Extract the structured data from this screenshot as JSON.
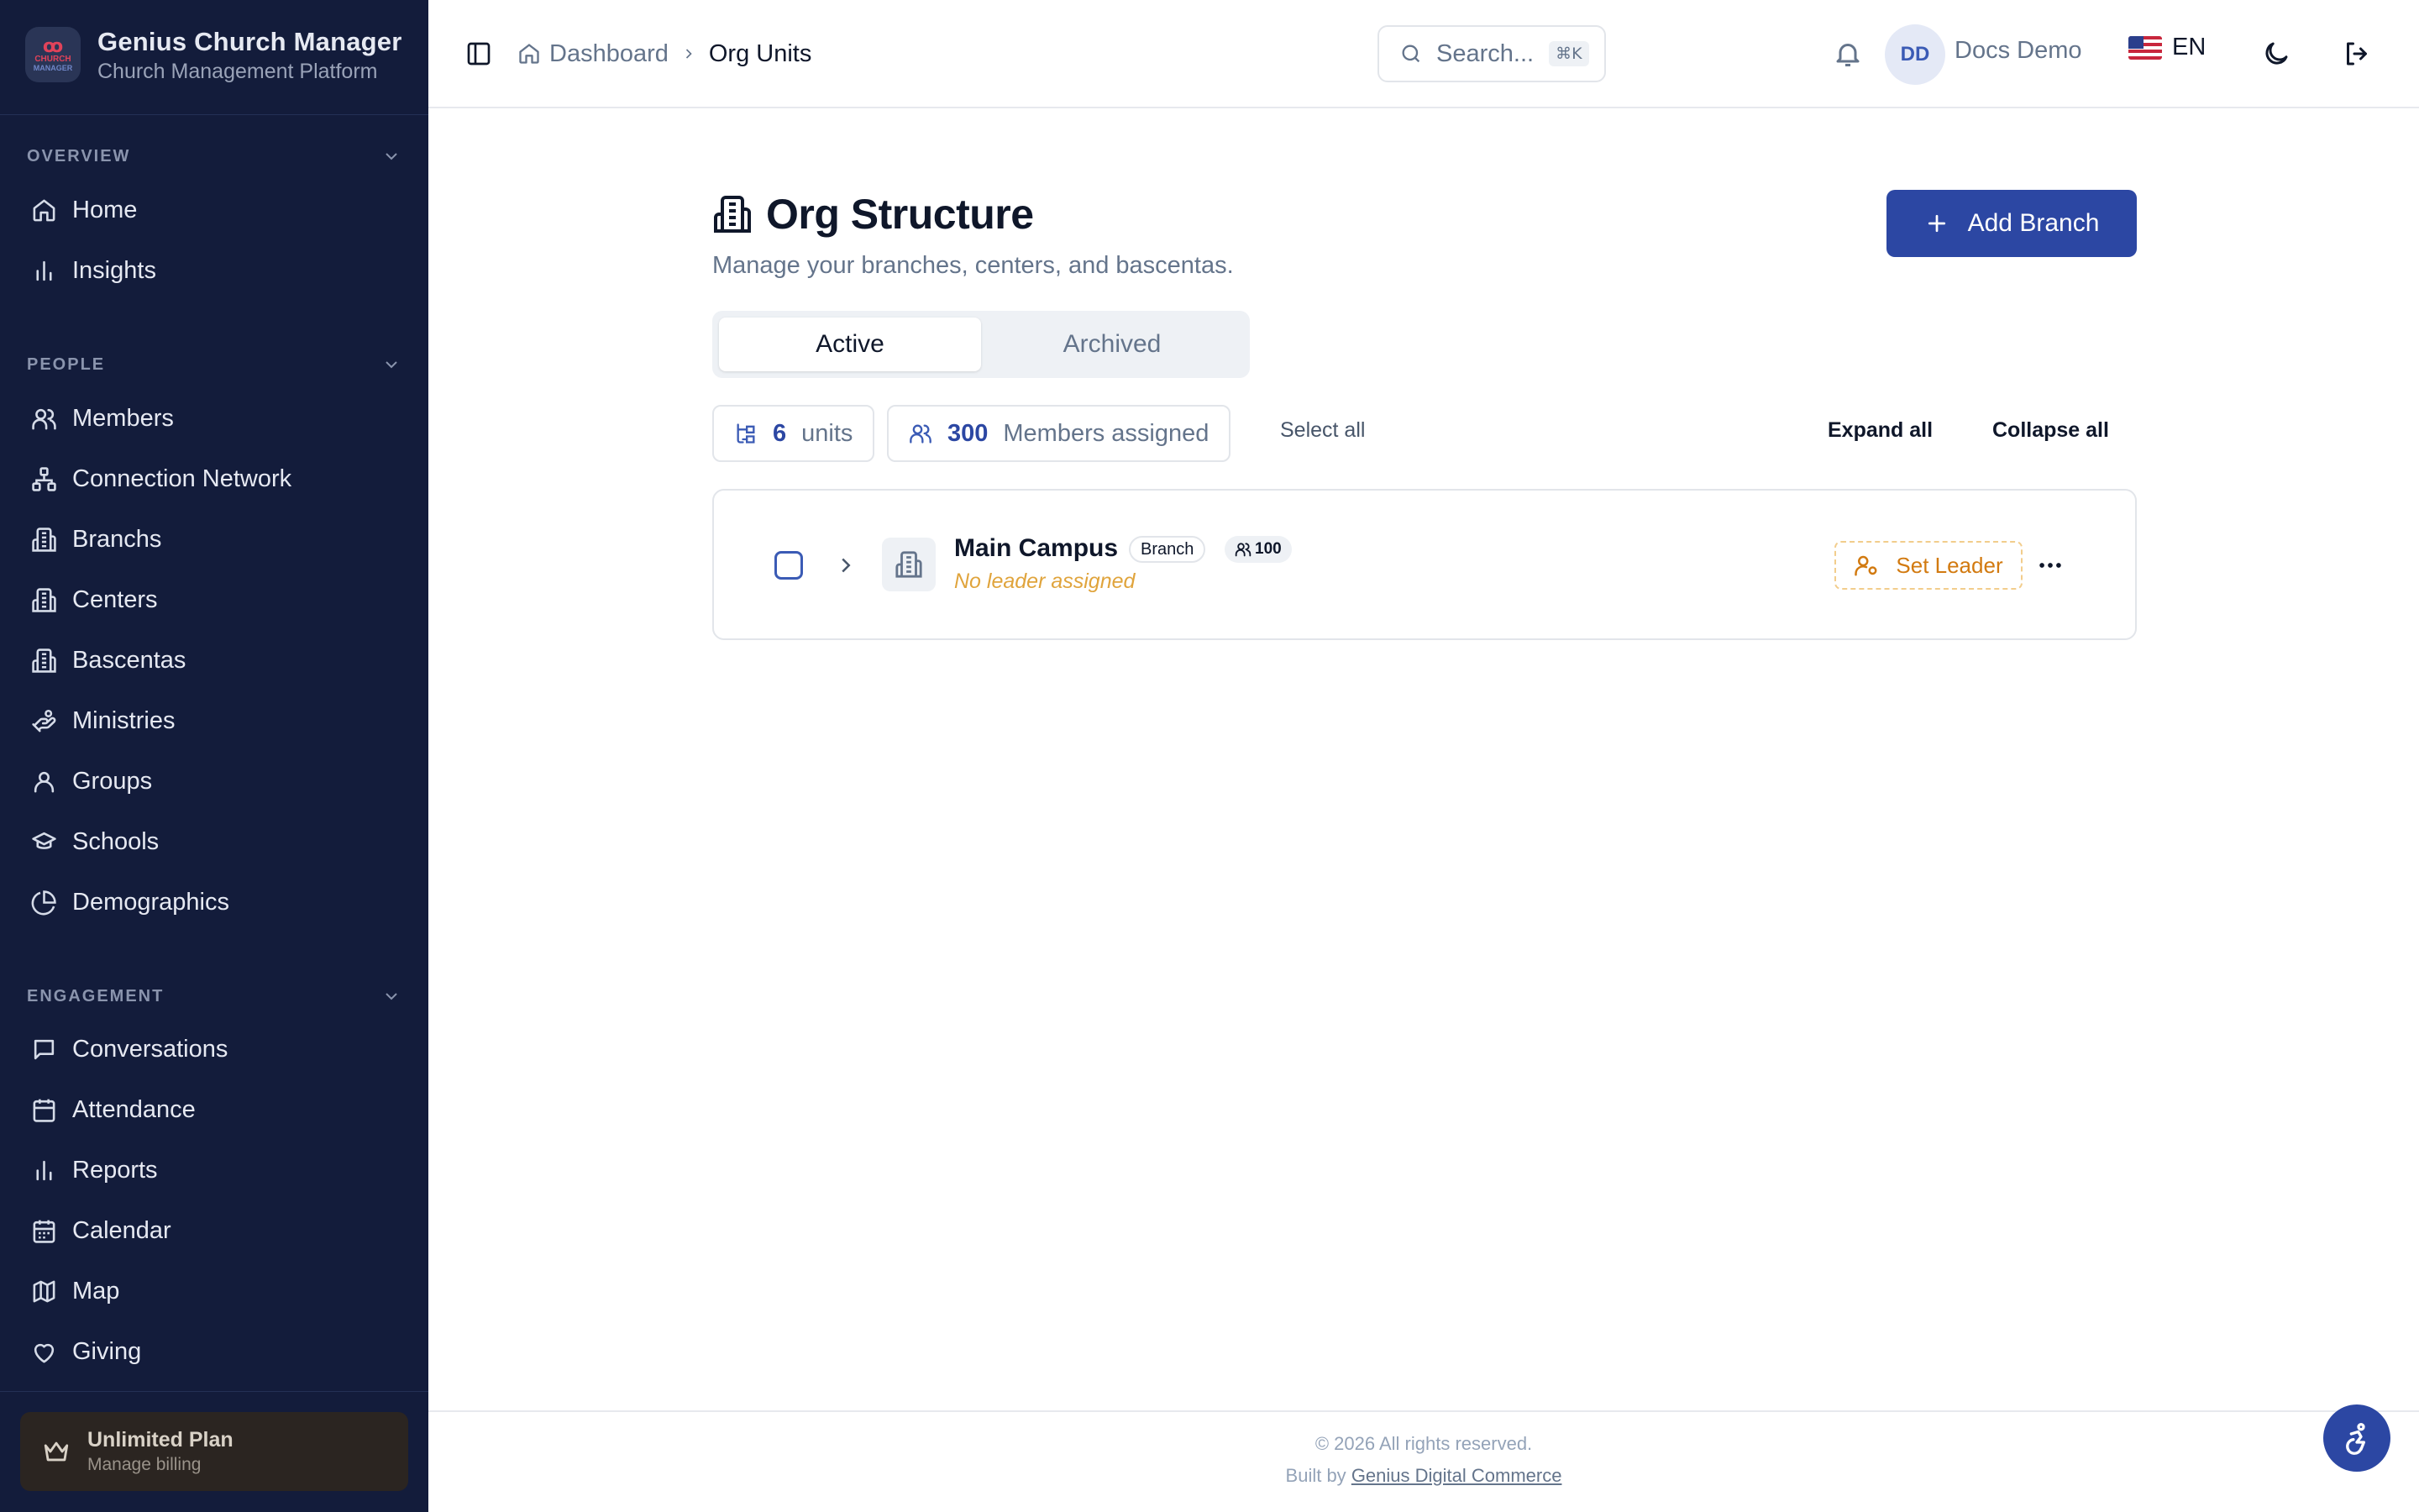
{
  "app": {
    "name": "Genius Church Manager",
    "subtitle": "Church Management Platform",
    "logo_lines": [
      "CHURCH",
      "MANAGER"
    ]
  },
  "sidebar": {
    "sections": [
      {
        "label": "OVERVIEW",
        "items": [
          {
            "label": "Home",
            "icon": "home-icon"
          },
          {
            "label": "Insights",
            "icon": "bar-chart-icon"
          }
        ]
      },
      {
        "label": "PEOPLE",
        "items": [
          {
            "label": "Members",
            "icon": "users-icon"
          },
          {
            "label": "Connection Network",
            "icon": "network-icon"
          },
          {
            "label": "Branchs",
            "icon": "building-icon"
          },
          {
            "label": "Centers",
            "icon": "building-icon"
          },
          {
            "label": "Bascentas",
            "icon": "building-icon"
          },
          {
            "label": "Ministries",
            "icon": "hand-icon"
          },
          {
            "label": "Groups",
            "icon": "users-icon"
          },
          {
            "label": "Schools",
            "icon": "graduation-cap-icon"
          },
          {
            "label": "Demographics",
            "icon": "pie-chart-icon"
          }
        ]
      },
      {
        "label": "ENGAGEMENT",
        "items": [
          {
            "label": "Conversations",
            "icon": "message-icon"
          },
          {
            "label": "Attendance",
            "icon": "calendar-check-icon"
          },
          {
            "label": "Reports",
            "icon": "bar-chart-icon"
          },
          {
            "label": "Calendar",
            "icon": "calendar-icon"
          },
          {
            "label": "Map",
            "icon": "map-icon"
          },
          {
            "label": "Giving",
            "icon": "heart-icon"
          }
        ]
      }
    ],
    "plan": {
      "title": "Unlimited Plan",
      "subtitle": "Manage billing"
    }
  },
  "header": {
    "breadcrumb": [
      "Dashboard",
      "Org Units"
    ],
    "search_placeholder": "Search...",
    "search_shortcut": "⌘K",
    "user_initials": "DD",
    "user_name": "Docs Demo",
    "language": "EN"
  },
  "main": {
    "title": "Org Structure",
    "description": "Manage your branches, centers, and bascentas.",
    "add_button": "Add Branch",
    "tabs": [
      {
        "label": "Active",
        "active": true
      },
      {
        "label": "Archived",
        "active": false
      }
    ],
    "stats": {
      "units_count": "6",
      "units_label": "units",
      "members_count": "300",
      "members_label": "Members assigned"
    },
    "select_all": "Select all",
    "expand_all": "Expand all",
    "collapse_all": "Collapse all",
    "units": [
      {
        "name": "Main Campus",
        "type": "Branch",
        "member_count": "100",
        "leader_status": "No leader assigned",
        "set_leader": "Set Leader"
      }
    ]
  },
  "footer": {
    "copyright": "© 2026 All rights reserved.",
    "built_by": "Built by",
    "company": "Genius Digital Commerce"
  },
  "colors": {
    "sidebar_bg": "#131c3b",
    "primary": "#2c47a3",
    "warning": "#d27a10",
    "plan_bg": "#2b2521"
  }
}
